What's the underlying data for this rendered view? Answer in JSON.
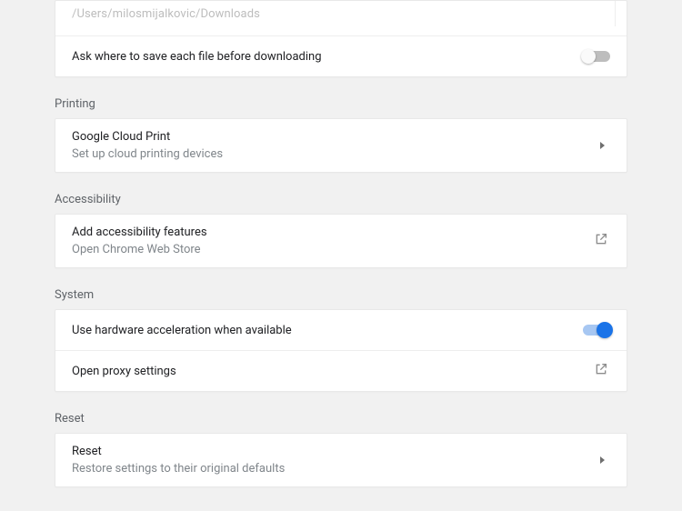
{
  "downloads": {
    "path": "/Users/milosmijalkovic/Downloads",
    "ask_where_label": "Ask where to save each file before downloading",
    "ask_where_on": false
  },
  "printing": {
    "title": "Printing",
    "cloud_print_label": "Google Cloud Print",
    "cloud_print_sub": "Set up cloud printing devices"
  },
  "accessibility": {
    "title": "Accessibility",
    "add_label": "Add accessibility features",
    "add_sub": "Open Chrome Web Store"
  },
  "system": {
    "title": "System",
    "hw_accel_label": "Use hardware acceleration when available",
    "hw_accel_on": true,
    "proxy_label": "Open proxy settings"
  },
  "reset": {
    "title": "Reset",
    "reset_label": "Reset",
    "reset_sub": "Restore settings to their original defaults"
  }
}
